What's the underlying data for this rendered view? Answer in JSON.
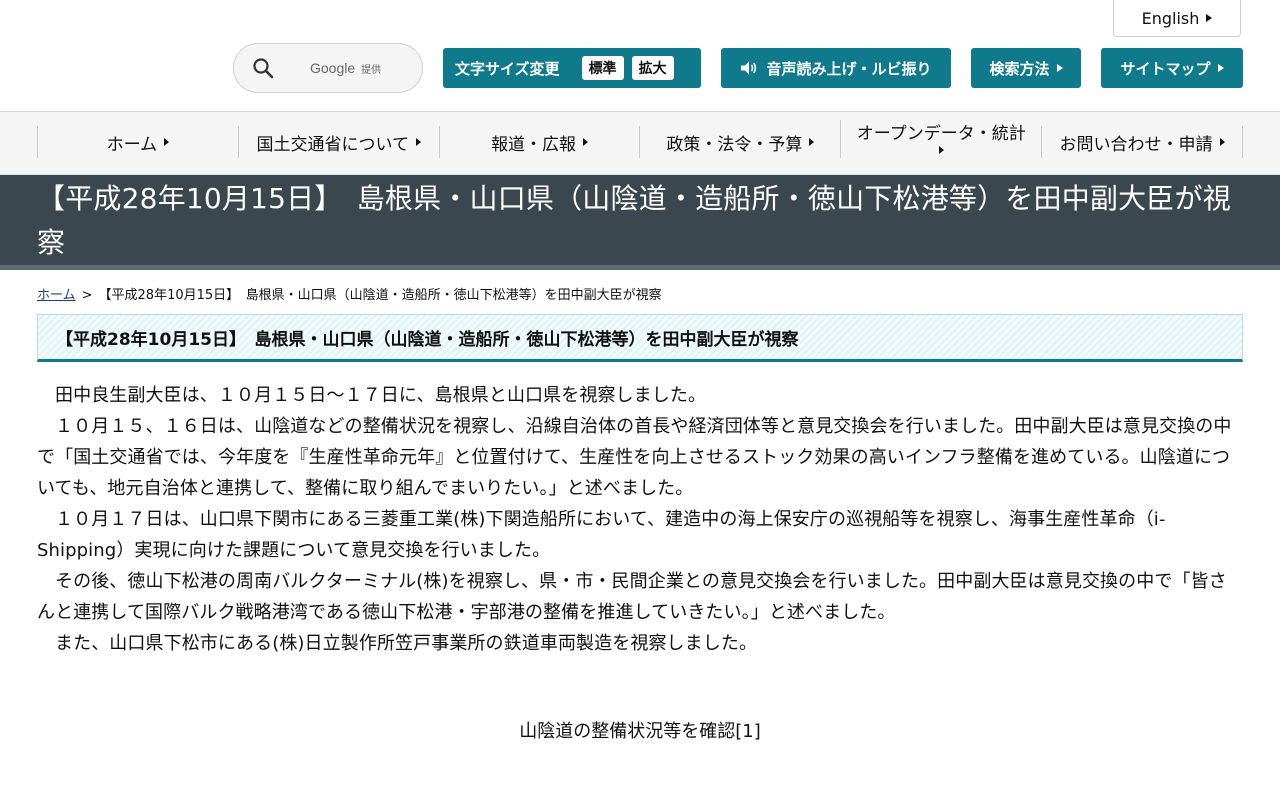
{
  "header": {
    "language_label": "English",
    "search": {
      "google_mark": "Google",
      "google_sub": "提供"
    },
    "font_size": {
      "label": "文字サイズ変更",
      "standard": "標準",
      "large": "拡大"
    },
    "voice_label": "音声読み上げ・ルビ振り",
    "search_help_label": "検索方法",
    "sitemap_label": "サイトマップ"
  },
  "nav": {
    "items": [
      {
        "label": "ホーム"
      },
      {
        "label": "国土交通省について"
      },
      {
        "label": "報道・広報"
      },
      {
        "label": "政策・法令・予算"
      },
      {
        "label": "オープンデータ・統計"
      },
      {
        "label": "お問い合わせ・申請"
      }
    ]
  },
  "page": {
    "title": "【平成28年10月15日】　島根県・山口県（山陰道・造船所・徳山下松港等）を田中副大臣が視察",
    "breadcrumb": {
      "home": "ホーム",
      "separator": ">",
      "current": "【平成28年10月15日】　島根県・山口県（山陰道・造船所・徳山下松港等）を田中副大臣が視察"
    },
    "heading": "【平成28年10月15日】　島根県・山口県（山陰道・造船所・徳山下松港等）を田中副大臣が視察",
    "paragraphs": [
      "田中良生副大臣は、１０月１５日～１７日に、島根県と山口県を視察しました。",
      "１０月１５、１６日は、山陰道などの整備状況を視察し、沿線自治体の首長や経済団体等と意見交換会を行いました。田中副大臣は意見交換の中で「国土交通省では、今年度を『生産性革命元年』と位置付けて、生産性を向上させるストック効果の高いインフラ整備を進めている。山陰道についても、地元自治体と連携して、整備に取り組んでまいりたい。」と述べました。",
      "１０月１７日は、山口県下関市にある三菱重工業(株)下関造船所において、建造中の海上保安庁の巡視船等を視察し、海事生産性革命（i-Shipping）実現に向けた課題について意見交換を行いました。",
      "その後、徳山下松港の周南バルクターミナル(株)を視察し、県・市・民間企業との意見交換会を行いました。田中副大臣は意見交換の中で「皆さんと連携して国際バルク戦略港湾である徳山下松港・宇部港の整備を推進していきたい。」と述べました。",
      "また、山口県下松市にある(株)日立製作所笠戸事業所の鉄道車両製造を視察しました。"
    ],
    "caption": "山陰道の整備状況等を確認[1]"
  },
  "colors": {
    "accent": "#0f7a8c",
    "hero_bg": "#3b474e",
    "link": "#1a3d8f"
  }
}
